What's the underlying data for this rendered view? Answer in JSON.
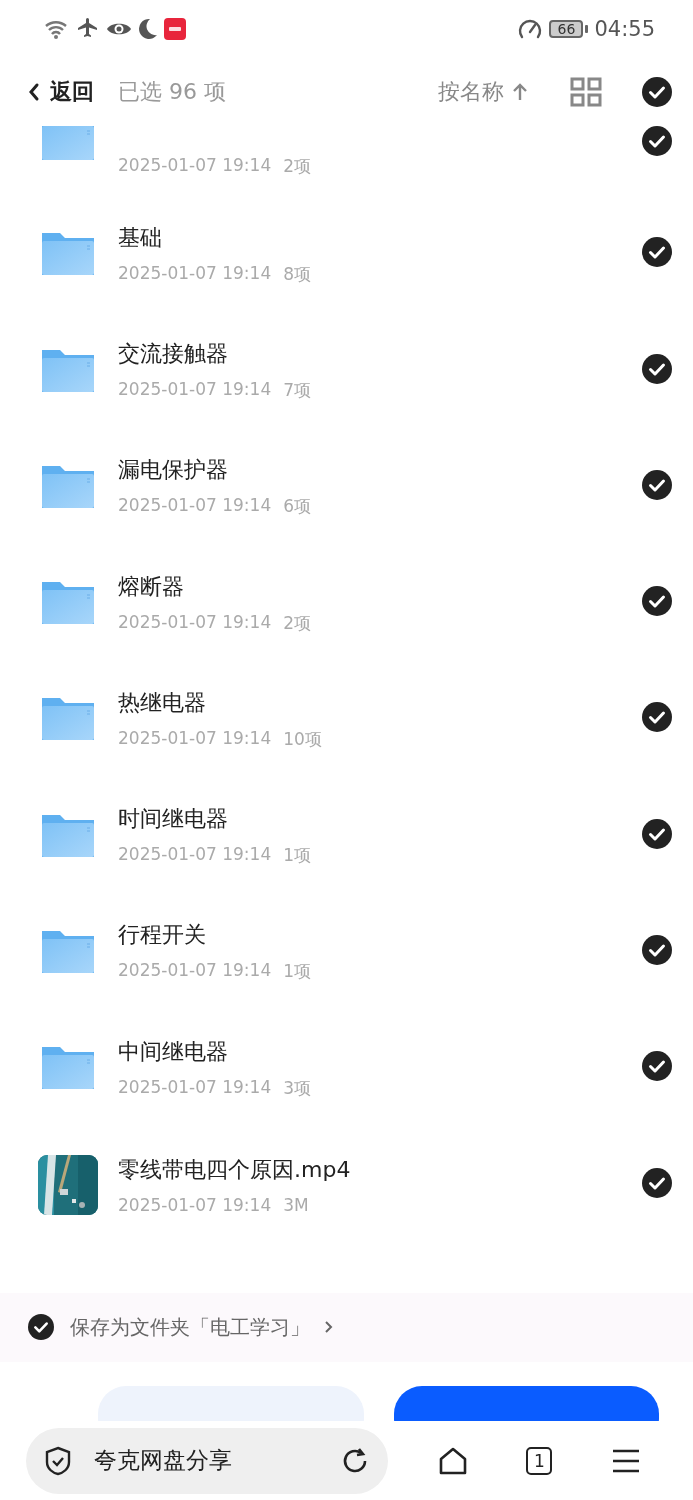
{
  "status_bar": {
    "battery": "66",
    "time": "04:55"
  },
  "header": {
    "back": "返回",
    "selection": "已选 96 项",
    "sort": "按名称",
    "all_checked": true
  },
  "items": [
    {
      "kind": "folder",
      "partial": true,
      "date": "2025-01-07 19:14",
      "size": "2项",
      "checked": true
    },
    {
      "kind": "folder",
      "name": "基础",
      "date": "2025-01-07 19:14",
      "size": "8项",
      "checked": true
    },
    {
      "kind": "folder",
      "name": "交流接触器",
      "date": "2025-01-07 19:14",
      "size": "7项",
      "checked": true
    },
    {
      "kind": "folder",
      "name": "漏电保护器",
      "date": "2025-01-07 19:14",
      "size": "6项",
      "checked": true
    },
    {
      "kind": "folder",
      "name": "熔断器",
      "date": "2025-01-07 19:14",
      "size": "2项",
      "checked": true
    },
    {
      "kind": "folder",
      "name": "热继电器",
      "date": "2025-01-07 19:14",
      "size": "10项",
      "checked": true
    },
    {
      "kind": "folder",
      "name": "时间继电器",
      "date": "2025-01-07 19:14",
      "size": "1项",
      "checked": true
    },
    {
      "kind": "folder",
      "name": "行程开关",
      "date": "2025-01-07 19:14",
      "size": "1项",
      "checked": true
    },
    {
      "kind": "folder",
      "name": "中间继电器",
      "date": "2025-01-07 19:14",
      "size": "3项",
      "checked": true
    },
    {
      "kind": "video",
      "name": "零线带电四个原因.mp4",
      "date": "2025-01-07 19:14",
      "size": "3M",
      "checked": true
    }
  ],
  "save_option": {
    "text": "保存为文件夹「电工学习」",
    "checked": true
  },
  "action_buttons": [
    {
      "kind": "secondary"
    },
    {
      "kind": "primary"
    }
  ],
  "browser_bar": {
    "title": "夸克网盘分享",
    "tab_count": "1"
  }
}
